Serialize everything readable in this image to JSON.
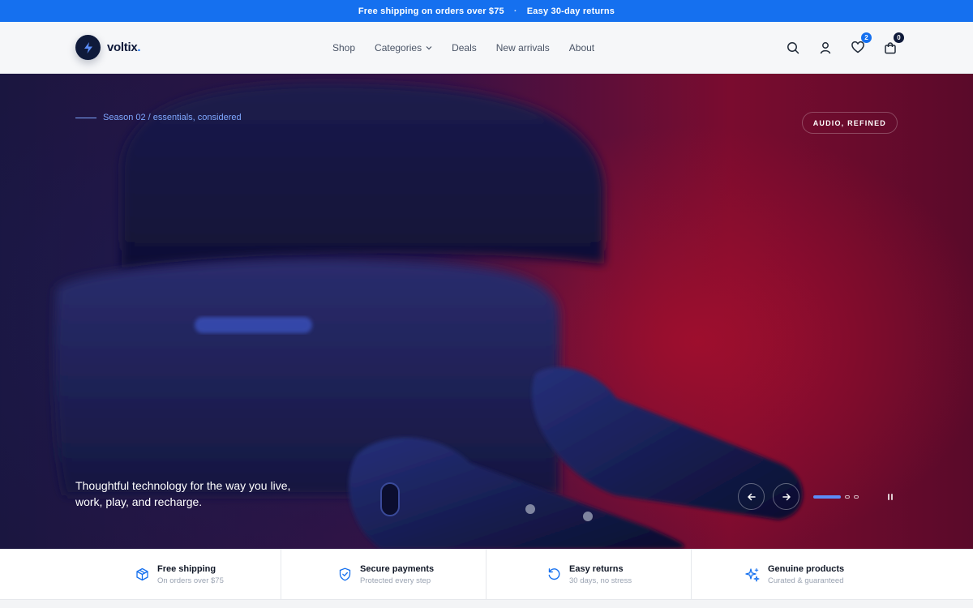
{
  "announcement": {
    "left": "Free shipping on orders over $75",
    "separator": "·",
    "right": "Easy 30-day returns"
  },
  "header": {
    "brand": "voltix",
    "brand_dot": ".",
    "nav": [
      {
        "label": "Shop"
      },
      {
        "label": "Categories"
      },
      {
        "label": "Deals"
      },
      {
        "label": "New arrivals"
      },
      {
        "label": "About"
      }
    ],
    "wishlist_count": "2",
    "cart_count": "0"
  },
  "hero": {
    "eyebrow": "Season 02 / essentials, considered",
    "pill": "AUDIO, REFINED",
    "tagline": "Thoughtful technology for the way you live, work, play, and recharge.",
    "slide_active": 1,
    "slide_count": 3
  },
  "features": [
    {
      "title": "Free shipping",
      "sub": "On orders over $75",
      "icon": "package-icon"
    },
    {
      "title": "Secure payments",
      "sub": "Protected every step",
      "icon": "shield-check-icon"
    },
    {
      "title": "Easy returns",
      "sub": "30 days, no stress",
      "icon": "refresh-icon"
    },
    {
      "title": "Genuine products",
      "sub": "Curated & guaranteed",
      "icon": "sparkle-icon"
    }
  ],
  "colors": {
    "accent": "#1570ef",
    "brand_dark": "#0f1a3a"
  }
}
